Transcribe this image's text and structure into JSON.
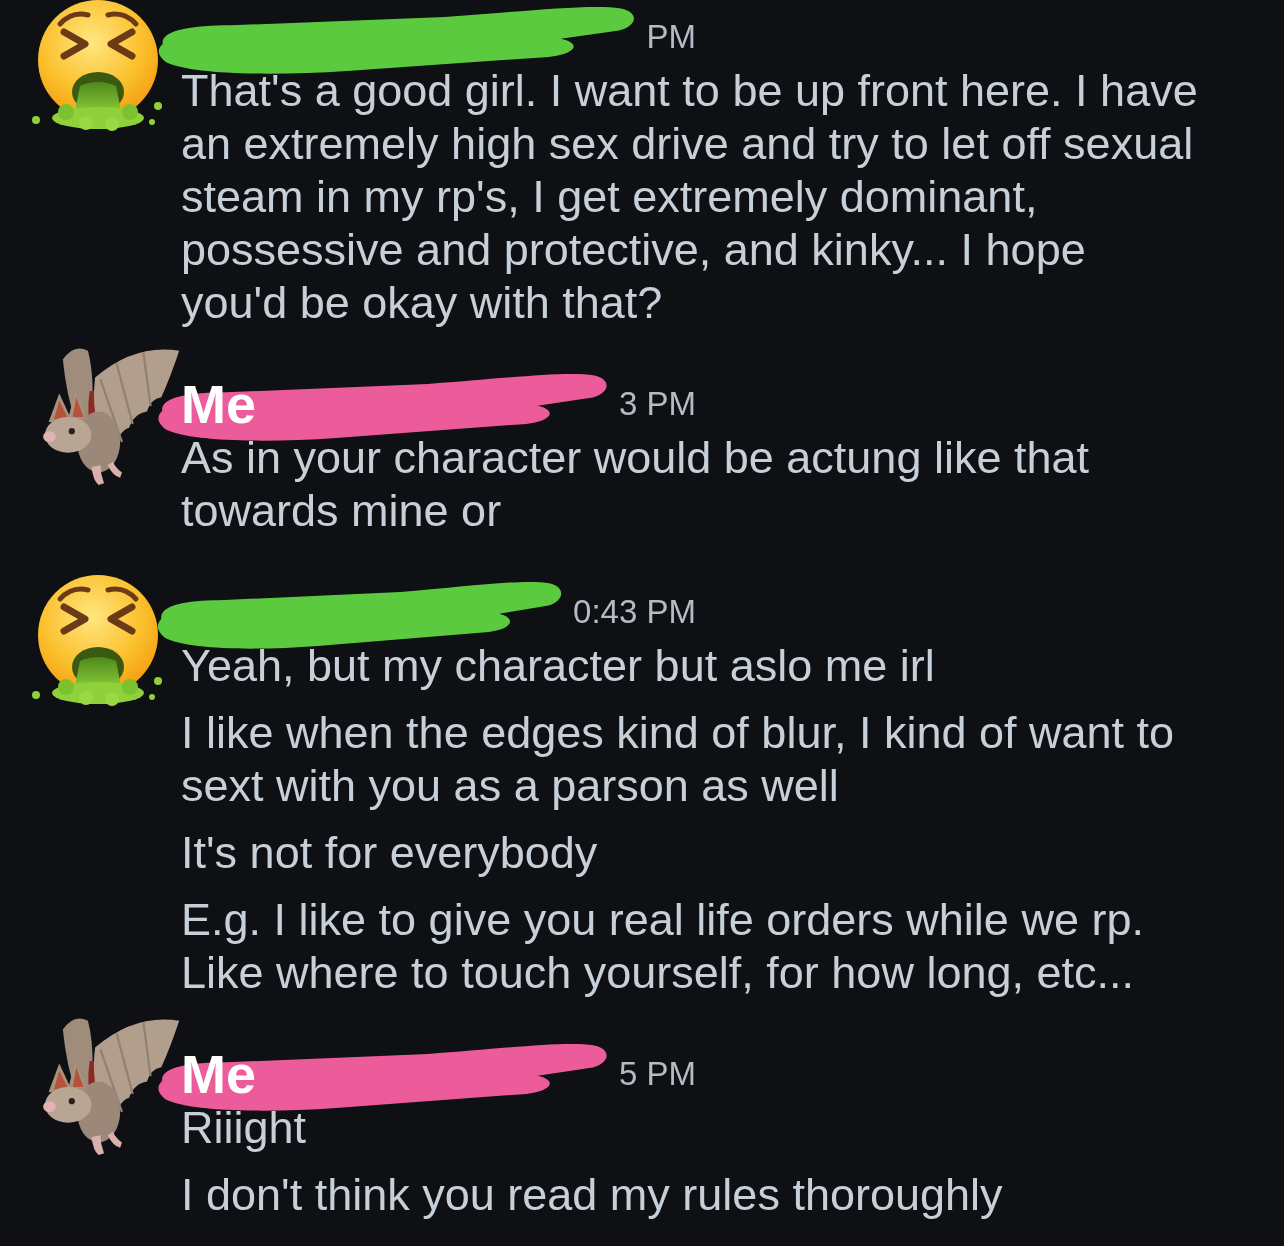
{
  "messages": [
    {
      "kind": "them",
      "redaction": {
        "color": "#5cca3f"
      },
      "timestamp": "PM",
      "paragraphs": [
        "That's a good girl. I want to be up front here. I have an extremely high sex drive and try to let off sexual steam in my rp's, I get extremely dominant, possessive and protective, and kinky... I hope you'd be okay with that?"
      ]
    },
    {
      "kind": "me",
      "author": "Me",
      "redaction": {
        "color": "#ec5b9a"
      },
      "timestamp": "3 PM",
      "paragraphs": [
        "As in your character would be actung like that towards mine or"
      ]
    },
    {
      "kind": "them",
      "redaction": {
        "color": "#5cca3f"
      },
      "timestamp": "0:43 PM",
      "paragraphs": [
        "Yeah, but my character but aslo me irl",
        "I like when the edges kind of blur, I kind of want to sext with you as a parson as well",
        "It's not for everybody",
        "E.g. I like to give you real life orders while we rp. Like where to touch yourself, for how long, etc..."
      ]
    },
    {
      "kind": "me",
      "author": "Me",
      "redaction": {
        "color": "#ec5b9a"
      },
      "timestamp": "5 PM",
      "paragraphs": [
        "Riiight",
        "I don't think you read my rules thoroughly"
      ]
    }
  ]
}
